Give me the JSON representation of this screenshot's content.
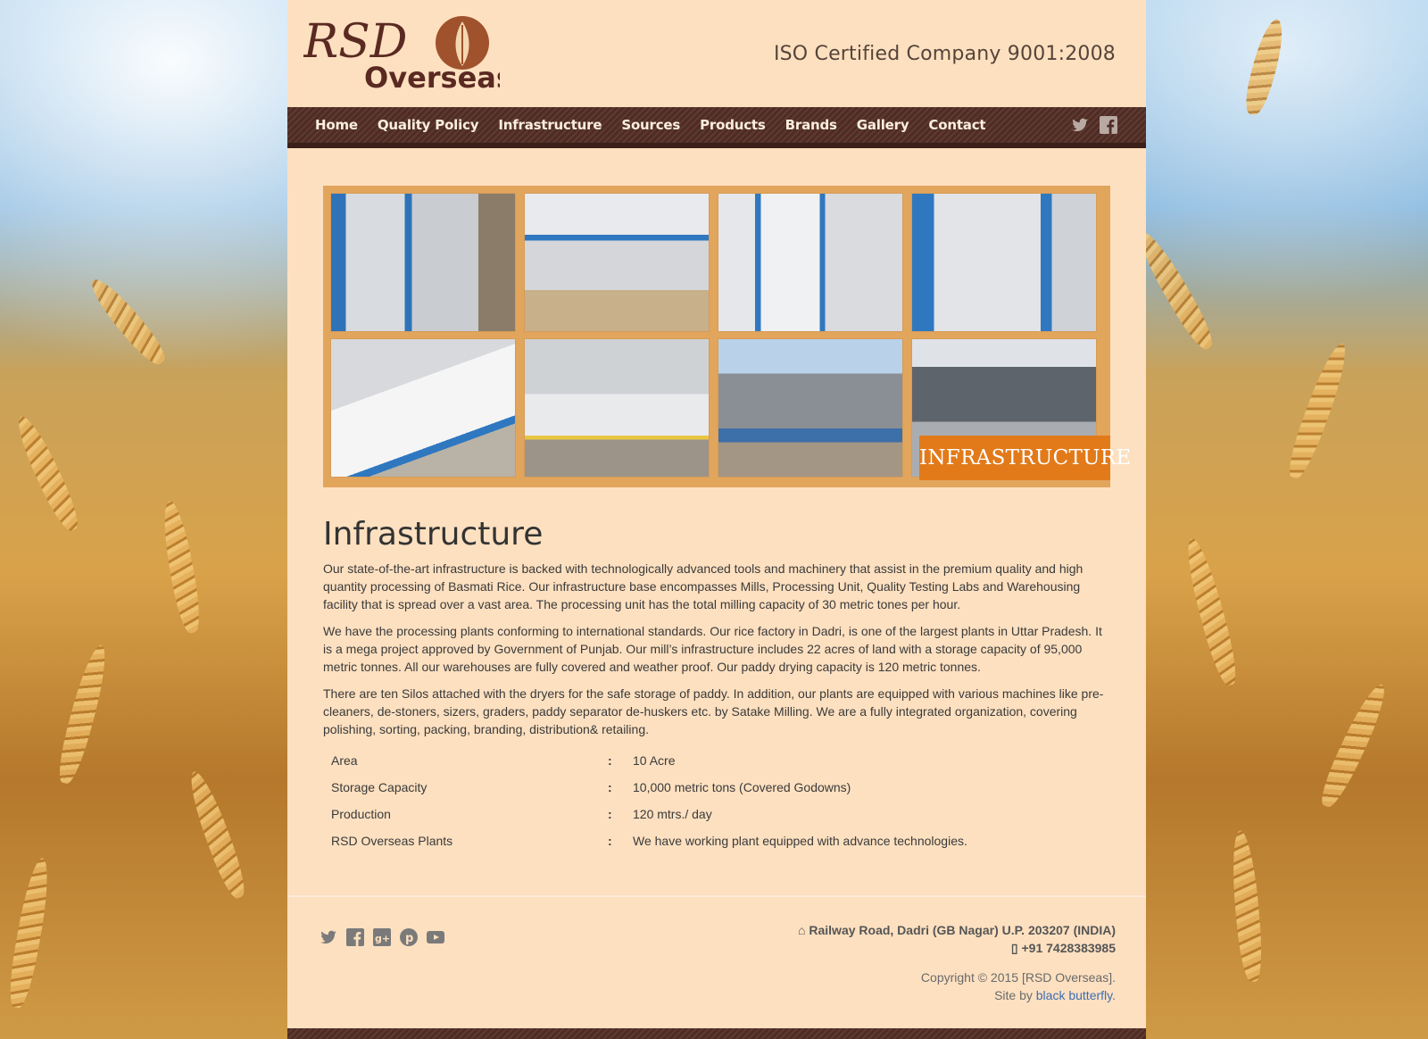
{
  "header": {
    "logo_text": "RSD Overseas",
    "iso_text": "ISO Certified Company 9001:2008"
  },
  "nav": {
    "items": [
      "Home",
      "Quality Policy",
      "Infrastructure",
      "Sources",
      "Products",
      "Brands",
      "Gallery",
      "Contact"
    ],
    "social_icons": [
      "twitter-icon",
      "facebook-icon"
    ]
  },
  "banner": {
    "label": "INFRASTRUCTURE"
  },
  "main": {
    "title": "Infrastructure",
    "paragraphs": [
      "Our state-of-the-art infrastructure is backed with technologically advanced tools and machinery that assist in the premium quality and high quantity processing of Basmati Rice. Our infrastructure base encompasses Mills, Processing Unit, Quality Testing Labs and Warehousing facility that is spread over a vast area. The processing unit has the total milling capacity of 30 metric tones per hour.",
      "We have the processing plants conforming to international standards. Our rice factory in Dadri, is one of the largest plants in Uttar Pradesh. It is a mega project approved by Government of Punjab. Our mill’s infrastructure includes 22 acres of land with a storage capacity of 95,000 metric tonnes. All our warehouses are fully covered and weather proof. Our paddy drying capacity is 120 metric tonnes.",
      "There are ten Silos attached with the dryers for the safe storage of paddy. In addition, our plants are equipped with various machines like pre-cleaners, de-stoners, sizers, graders, paddy separator de-huskers etc. by Satake Milling. We are a fully integrated organization, covering polishing, sorting, packing, branding, distribution& retailing."
    ],
    "specs": [
      {
        "label": "Area",
        "sep": ":",
        "value": "10 Acre"
      },
      {
        "label": "Storage Capacity",
        "sep": ":",
        "value": "10,000 metric tons (Covered Godowns)"
      },
      {
        "label": "Production",
        "sep": ":",
        "value": "120 mtrs./ day"
      },
      {
        "label": "RSD Overseas Plants",
        "sep": ":",
        "value": "We have working plant equipped with advance technologies."
      }
    ]
  },
  "footer": {
    "social_icons": [
      "twitter-icon",
      "facebook-icon",
      "google-plus-icon",
      "pinterest-icon",
      "youtube-icon"
    ],
    "address": "Railway Road, Dadri (GB Nagar) U.P. 203207 (INDIA)",
    "phone": "+91 7428383985",
    "copyright": "Copyright © 2015 [RSD Overseas].",
    "site_by_prefix": "Site by",
    "site_by_link": "black butterfly",
    "site_by_suffix": "."
  },
  "colors": {
    "page_bg": "#fde0c0",
    "nav_bg": "#4e2c25",
    "banner_frame": "#e2a55c",
    "banner_label": "#e27a1a",
    "link": "#3b6db5"
  }
}
